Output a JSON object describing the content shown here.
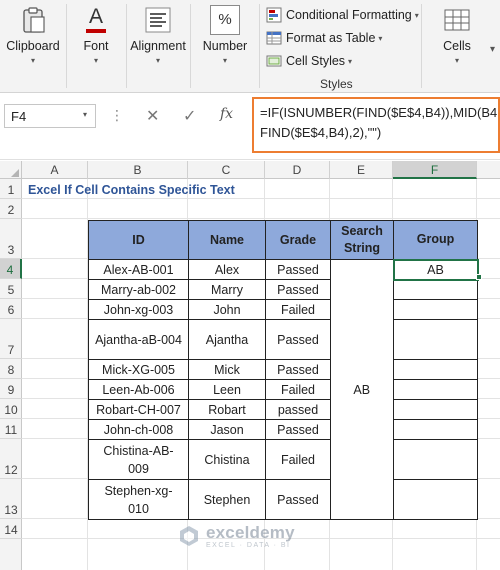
{
  "ribbon": {
    "clipboard": "Clipboard",
    "font": "Font",
    "alignment": "Alignment",
    "number": "Number",
    "number_symbol": "%",
    "font_symbol": "A",
    "conditional_formatting": "Conditional Formatting",
    "format_as_table": "Format as Table",
    "cell_styles": "Cell Styles",
    "styles_group": "Styles",
    "cells": "Cells",
    "caret": "▾"
  },
  "formula_bar": {
    "name_box": "F4",
    "cancel": "✕",
    "enter": "✓",
    "fx": "fx",
    "formula": "=IF(ISNUMBER(FIND($E$4,B4)),MID(B4,\nFIND($E$4,B4),2),\"\")"
  },
  "grid": {
    "columns": [
      "A",
      "B",
      "C",
      "D",
      "E",
      "F"
    ],
    "rows": [
      "1",
      "2",
      "3",
      "4",
      "5",
      "6",
      "7",
      "8",
      "9",
      "10",
      "11",
      "12",
      "13",
      "14"
    ],
    "selected_column": "F",
    "selected_row": "4"
  },
  "sheet": {
    "title": "Excel If Cell Contains Specific Text",
    "headers": [
      "ID",
      "Name",
      "Grade",
      "Search String",
      "Group"
    ],
    "rows": [
      {
        "id": "Alex-AB-001",
        "name": "Alex",
        "grade": "Passed",
        "group": "AB"
      },
      {
        "id": "Marry-ab-002",
        "name": "Marry",
        "grade": "Passed",
        "group": ""
      },
      {
        "id": "John-xg-003",
        "name": "John",
        "grade": "Failed",
        "group": ""
      },
      {
        "id": "Ajantha-aB-004",
        "name": "Ajantha",
        "grade": "Passed",
        "group": ""
      },
      {
        "id": "Mick-XG-005",
        "name": "Mick",
        "grade": "Passed",
        "group": ""
      },
      {
        "id": "Leen-Ab-006",
        "name": "Leen",
        "grade": "Failed",
        "group": ""
      },
      {
        "id": "Robart-CH-007",
        "name": "Robart",
        "grade": "passed",
        "group": ""
      },
      {
        "id": "John-ch-008",
        "name": "Jason",
        "grade": "Passed",
        "group": ""
      },
      {
        "id": "Chistina-AB-009",
        "name": "Chistina",
        "grade": "Failed",
        "group": ""
      },
      {
        "id": "Stephen-xg-010",
        "name": "Stephen",
        "grade": "Passed",
        "group": ""
      }
    ],
    "search_string": "AB"
  },
  "watermark": {
    "name": "exceldemy",
    "tagline": "EXCEL · DATA · BI"
  },
  "colors": {
    "accent_green": "#217346",
    "header_blue": "#8ea9db",
    "title_blue": "#2f5597",
    "formula_border": "#ed7d31"
  }
}
